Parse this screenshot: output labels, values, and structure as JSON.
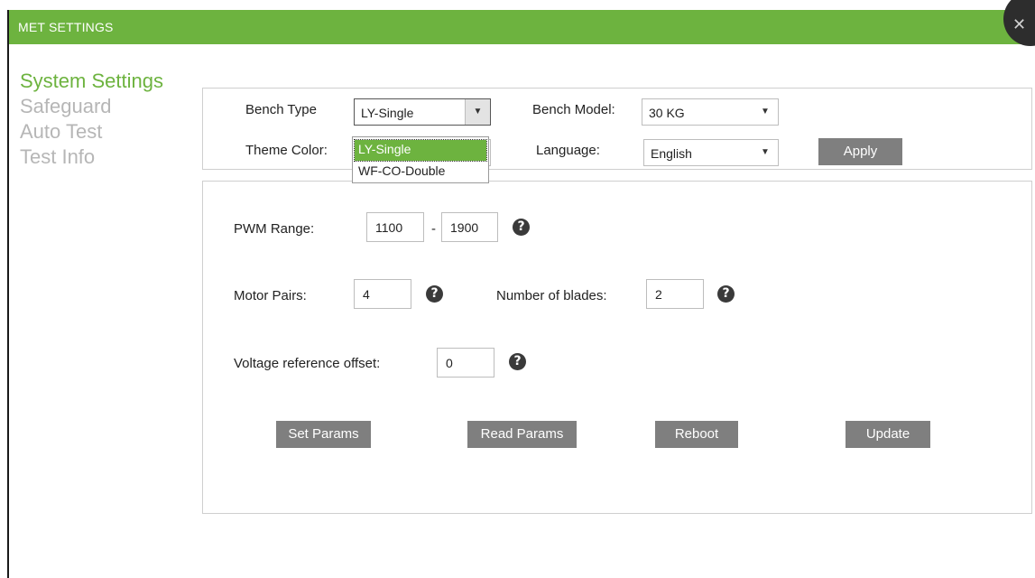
{
  "window": {
    "title": "MET SETTINGS"
  },
  "sidebar": {
    "items": [
      {
        "label": "System Settings",
        "active": true
      },
      {
        "label": "Safeguard",
        "active": false
      },
      {
        "label": "Auto Test",
        "active": false
      },
      {
        "label": "Test Info",
        "active": false
      }
    ]
  },
  "system": {
    "bench_type_label": "Bench Type",
    "bench_type_value": "LY-Single",
    "bench_type_options": [
      "LY-Single",
      "WF-CO-Double"
    ],
    "bench_model_label": "Bench Model:",
    "bench_model_value": "30 KG",
    "theme_color_label": "Theme Color:",
    "language_label": "Language:",
    "language_value": "English",
    "apply_label": "Apply"
  },
  "params": {
    "pwm_label": "PWM Range:",
    "pwm_min": "1100",
    "pwm_sep": "-",
    "pwm_max": "1900",
    "motor_pairs_label": "Motor Pairs:",
    "motor_pairs_value": "4",
    "blades_label": "Number of blades:",
    "blades_value": "2",
    "voltage_label": "Voltage reference offset:",
    "voltage_value": "0",
    "help_glyph": "?",
    "set_params_label": "Set Params",
    "read_params_label": "Read Params",
    "reboot_label": "Reboot",
    "update_label": "Update"
  },
  "colors": {
    "accent": "#6db33f",
    "button": "#7f7f7f",
    "nav_inactive": "#b6b6b6"
  }
}
